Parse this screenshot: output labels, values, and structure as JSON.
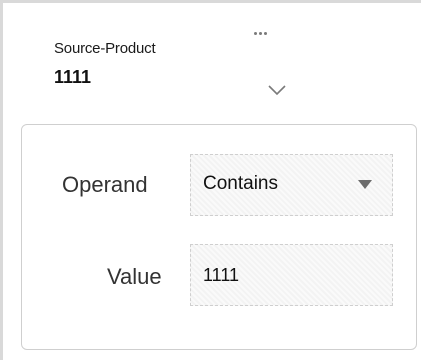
{
  "filter": {
    "field_title": "Source-Product",
    "field_value": "1111",
    "more_icon": "more-horizontal-icon",
    "expand_icon": "chevron-down-icon"
  },
  "panel": {
    "operand_label": "Operand",
    "operand_selected": "Contains",
    "value_label": "Value",
    "value_text": "1111"
  },
  "colors": {
    "border": "#cfcfcf",
    "text": "#333333",
    "arrow": "#6c6c6c"
  }
}
